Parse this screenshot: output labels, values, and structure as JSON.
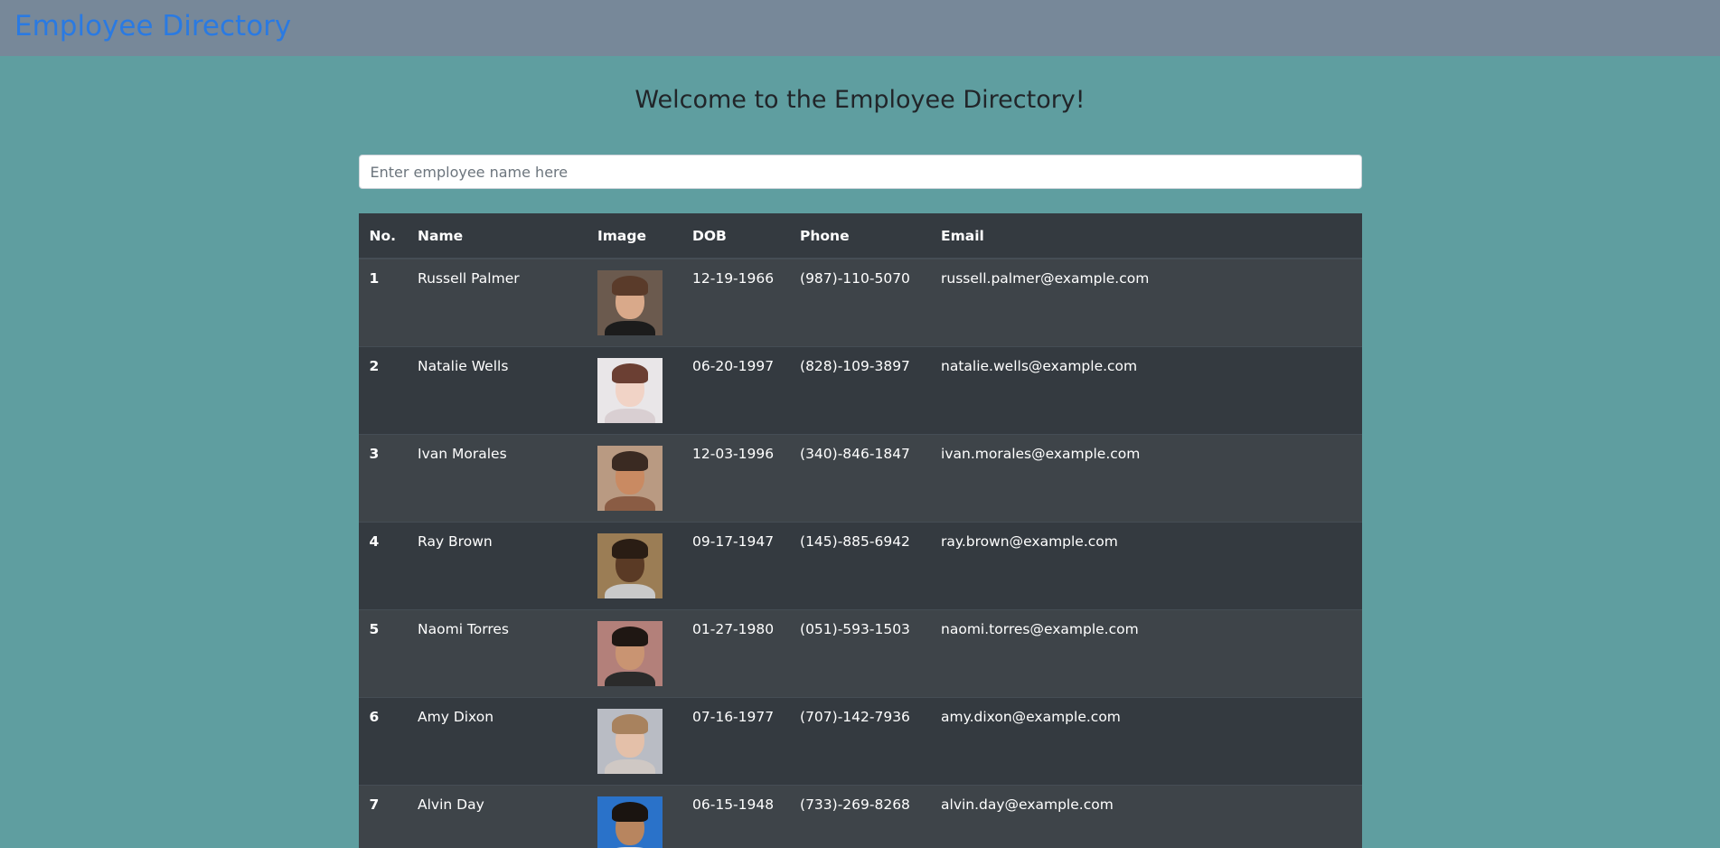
{
  "navbar": {
    "brand": "Employee Directory"
  },
  "page": {
    "heading": "Welcome to the Employee Directory!"
  },
  "search": {
    "placeholder": "Enter employee name here"
  },
  "table": {
    "headers": [
      "No.",
      "Name",
      "Image",
      "DOB",
      "Phone",
      "Email"
    ],
    "rows": [
      {
        "no": "1",
        "name": "Russell Palmer",
        "dob": "12-19-1966",
        "phone": "(987)-110-5070",
        "email": "russell.palmer@example.com",
        "image": {
          "icon": "avatar-photo",
          "bg": "#6b5a4e",
          "skin": "#d9a98a",
          "hair": "#5a3b2a",
          "shirt": "#1c1c1c"
        }
      },
      {
        "no": "2",
        "name": "Natalie Wells",
        "dob": "06-20-1997",
        "phone": "(828)-109-3897",
        "email": "natalie.wells@example.com",
        "image": {
          "icon": "avatar-photo",
          "bg": "#e9e6e8",
          "skin": "#f1d3c6",
          "hair": "#6b3f33",
          "shirt": "#d9cfd2"
        }
      },
      {
        "no": "3",
        "name": "Ivan Morales",
        "dob": "12-03-1996",
        "phone": "(340)-846-1847",
        "email": "ivan.morales@example.com",
        "image": {
          "icon": "avatar-photo",
          "bg": "#b99a82",
          "skin": "#c98a62",
          "hair": "#3a2a22",
          "shirt": "#8a5c44"
        }
      },
      {
        "no": "4",
        "name": "Ray Brown",
        "dob": "09-17-1947",
        "phone": "(145)-885-6942",
        "email": "ray.brown@example.com",
        "image": {
          "icon": "avatar-photo",
          "bg": "#9b7d55",
          "skin": "#5a3a25",
          "hair": "#2a1d14",
          "shirt": "#c9c9c9"
        }
      },
      {
        "no": "5",
        "name": "Naomi Torres",
        "dob": "01-27-1980",
        "phone": "(051)-593-1503",
        "email": "naomi.torres@example.com",
        "image": {
          "icon": "avatar-photo",
          "bg": "#b3807a",
          "skin": "#c99472",
          "hair": "#1f1713",
          "shirt": "#2b2b2b"
        }
      },
      {
        "no": "6",
        "name": "Amy Dixon",
        "dob": "07-16-1977",
        "phone": "(707)-142-7936",
        "email": "amy.dixon@example.com",
        "image": {
          "icon": "avatar-photo",
          "bg": "#b9bcc4",
          "skin": "#e4c0a9",
          "hair": "#a8825e",
          "shirt": "#cfc8c4"
        }
      },
      {
        "no": "7",
        "name": "Alvin Day",
        "dob": "06-15-1948",
        "phone": "(733)-269-8268",
        "email": "alvin.day@example.com",
        "image": {
          "icon": "avatar-photo",
          "bg": "#2a72c9",
          "skin": "#b8855f",
          "hair": "#1a1410",
          "shirt": "#e8e8e8"
        }
      }
    ]
  }
}
